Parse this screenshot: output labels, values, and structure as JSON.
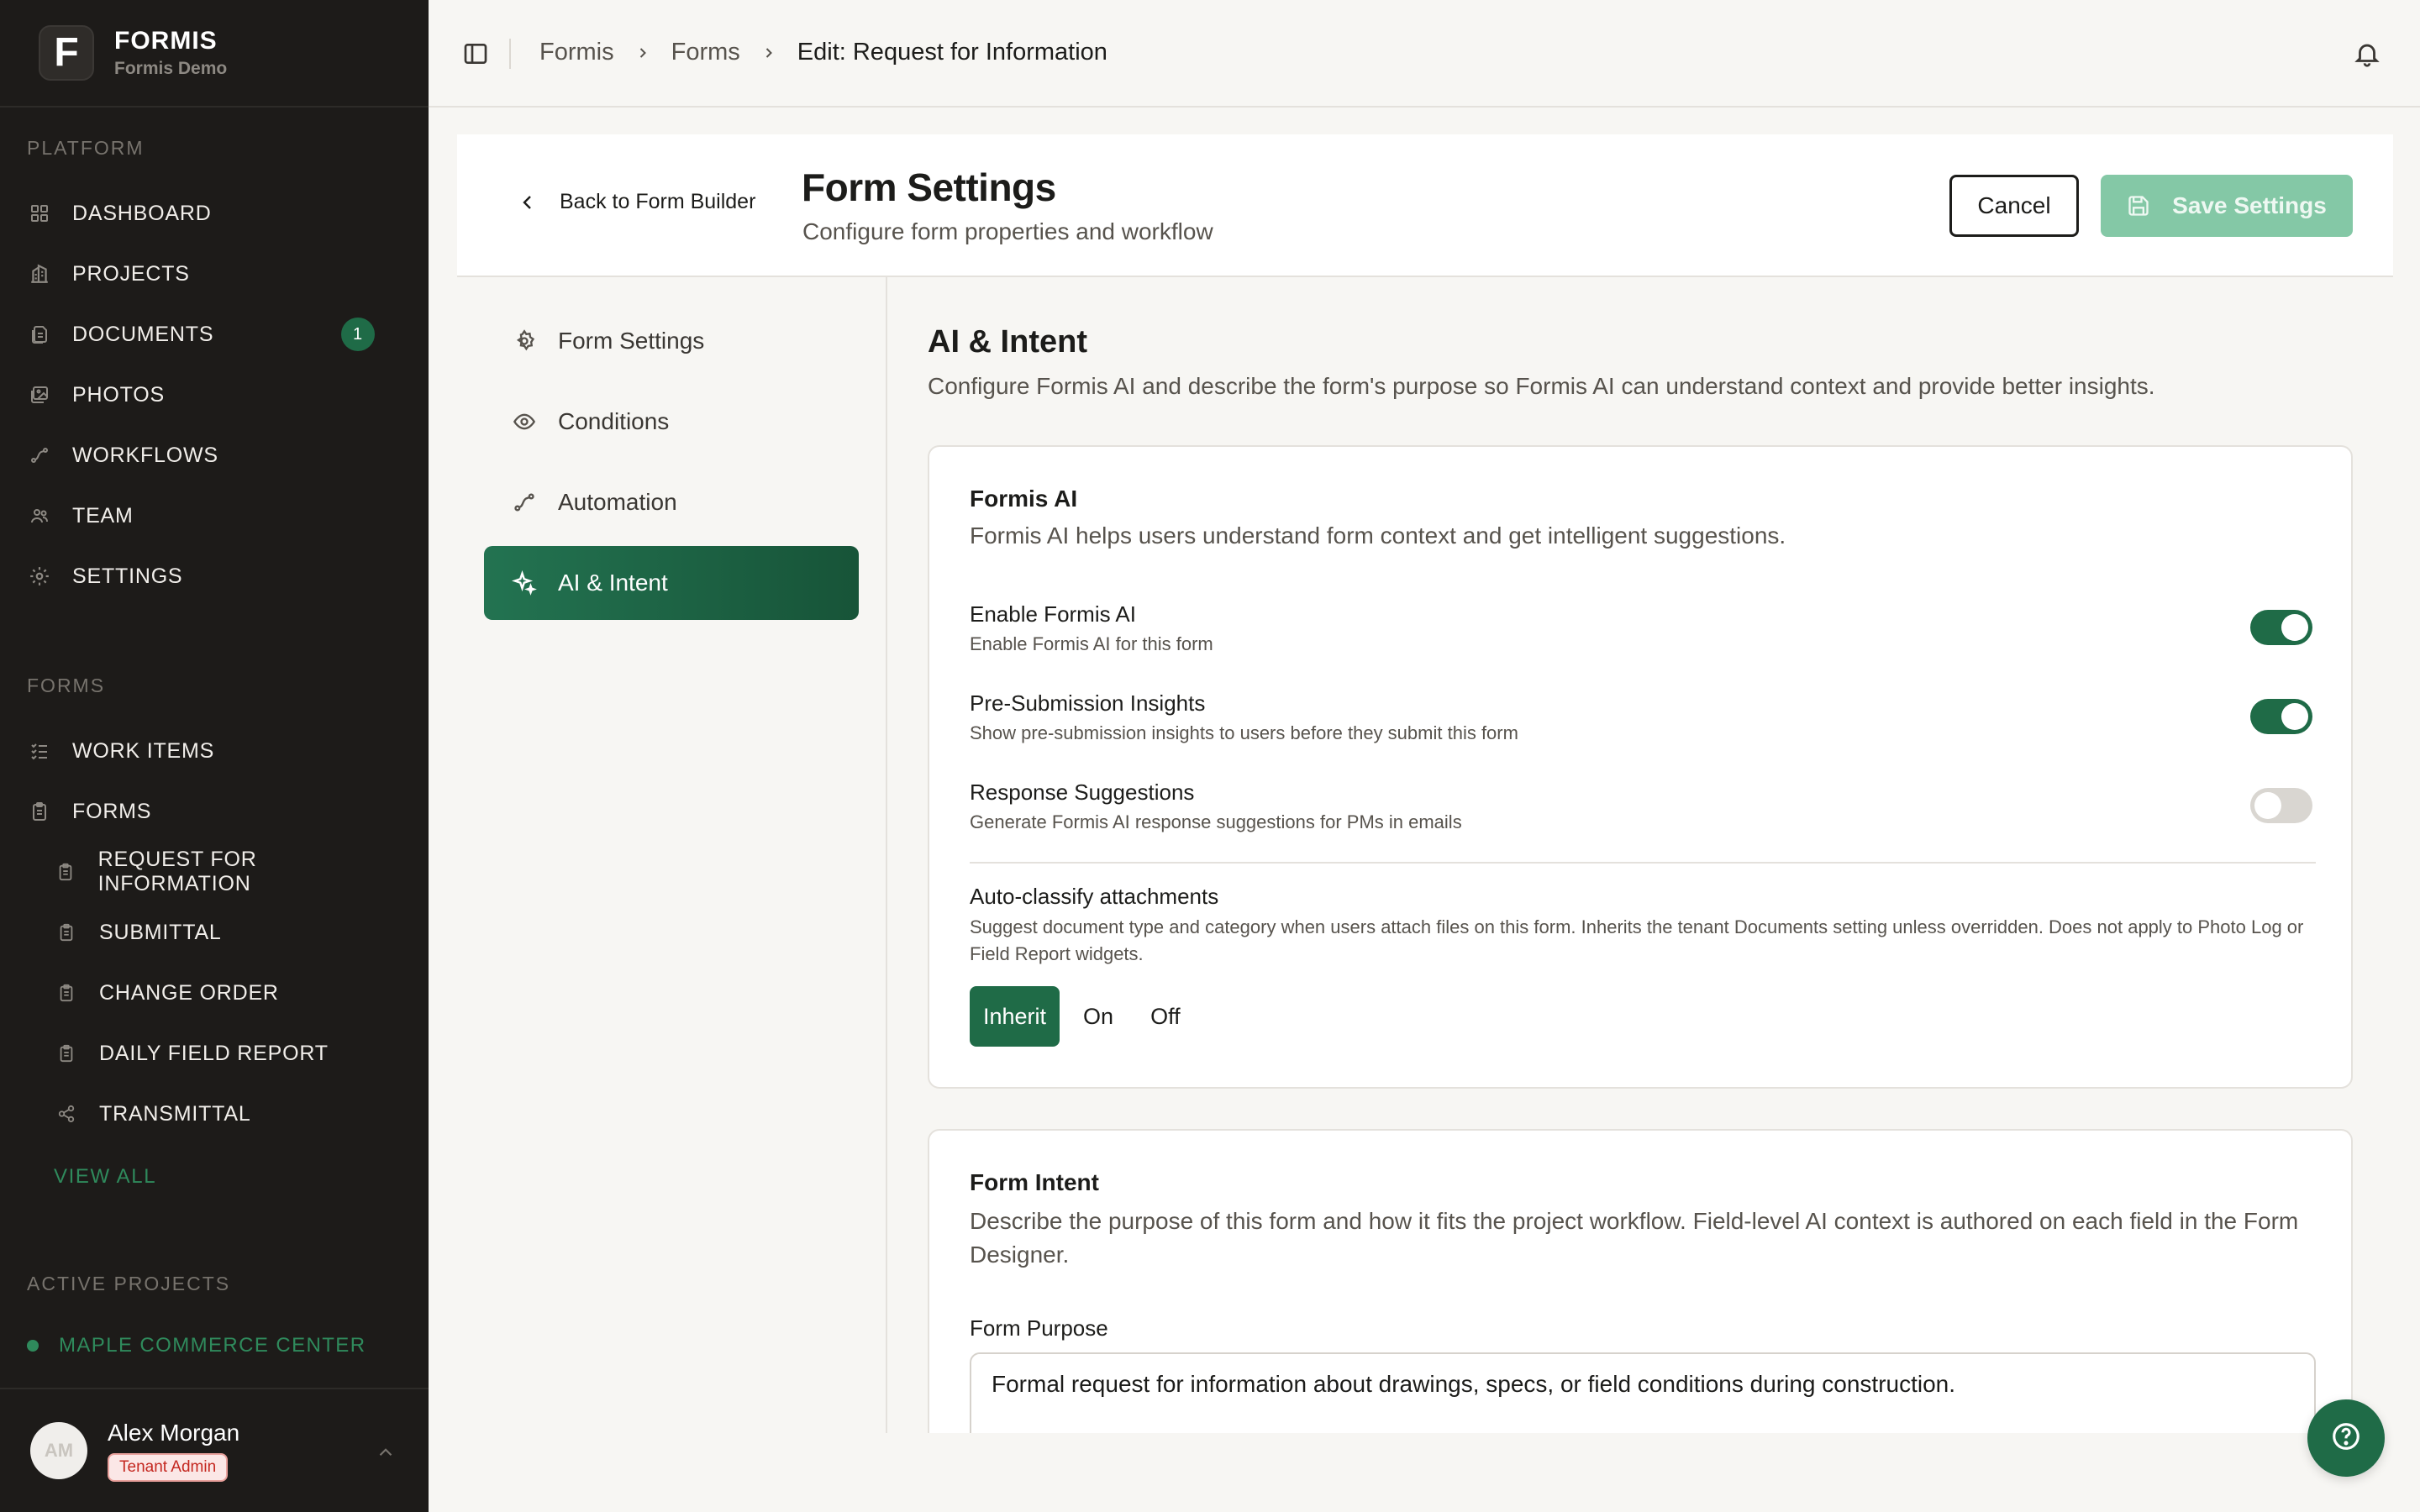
{
  "brand": {
    "name": "FORMIS",
    "subtitle": "Formis Demo",
    "logo_letter": "F"
  },
  "sidebar": {
    "platform_label": "PLATFORM",
    "platform_items": [
      {
        "label": "DASHBOARD",
        "icon": "grid-icon"
      },
      {
        "label": "PROJECTS",
        "icon": "building-icon"
      },
      {
        "label": "DOCUMENTS",
        "icon": "documents-icon",
        "badge": "1"
      },
      {
        "label": "PHOTOS",
        "icon": "photos-icon"
      },
      {
        "label": "WORKFLOWS",
        "icon": "workflow-icon"
      },
      {
        "label": "TEAM",
        "icon": "team-icon"
      },
      {
        "label": "SETTINGS",
        "icon": "gear-icon"
      }
    ],
    "forms_label": "FORMS",
    "forms_items": [
      {
        "label": "WORK ITEMS",
        "icon": "checklist-icon"
      },
      {
        "label": "FORMS",
        "icon": "clipboard-icon"
      }
    ],
    "form_subitems": [
      {
        "label": "REQUEST FOR INFORMATION",
        "icon": "clipboard-icon"
      },
      {
        "label": "SUBMITTAL",
        "icon": "clipboard-icon"
      },
      {
        "label": "CHANGE ORDER",
        "icon": "clipboard-icon"
      },
      {
        "label": "DAILY FIELD REPORT",
        "icon": "clipboard-icon"
      },
      {
        "label": "TRANSMITTAL",
        "icon": "share-icon"
      }
    ],
    "view_all": "VIEW ALL",
    "active_projects_label": "ACTIVE PROJECTS",
    "active_project": "MAPLE COMMERCE CENTER",
    "user": {
      "initials": "AM",
      "name": "Alex Morgan",
      "role": "Tenant Admin"
    }
  },
  "topbar": {
    "breadcrumbs": [
      "Formis",
      "Forms",
      "Edit: Request for Information"
    ]
  },
  "header": {
    "back_label": "Back to Form Builder",
    "title": "Form Settings",
    "subtitle": "Configure form properties and workflow",
    "cancel_label": "Cancel",
    "save_label": "Save Settings"
  },
  "settings_menu": [
    {
      "label": "Form Settings",
      "icon": "gear-icon",
      "active": false
    },
    {
      "label": "Conditions",
      "icon": "eye-icon",
      "active": false
    },
    {
      "label": "Automation",
      "icon": "workflow-icon",
      "active": false
    },
    {
      "label": "AI & Intent",
      "icon": "sparkles-icon",
      "active": true
    }
  ],
  "main": {
    "title": "AI & Intent",
    "description": "Configure Formis AI and describe the form's purpose so Formis AI can understand context and provide better insights.",
    "ai_card": {
      "title": "Formis AI",
      "description": "Formis AI helps users understand form context and get intelligent suggestions.",
      "options": [
        {
          "title": "Enable Formis AI",
          "description": "Enable Formis AI for this form",
          "enabled": true
        },
        {
          "title": "Pre-Submission Insights",
          "description": "Show pre-submission insights to users before they submit this form",
          "enabled": true
        },
        {
          "title": "Response Suggestions",
          "description": "Generate Formis AI response suggestions for PMs in emails",
          "enabled": false
        }
      ],
      "classify": {
        "title": "Auto-classify attachments",
        "description": "Suggest document type and category when users attach files on this form. Inherits the tenant Documents setting unless overridden. Does not apply to Photo Log or Field Report widgets.",
        "choices": [
          "Inherit",
          "On",
          "Off"
        ],
        "selected": "Inherit"
      }
    },
    "intent_card": {
      "title": "Form Intent",
      "description": "Describe the purpose of this form and how it fits the project workflow. Field-level AI context is authored on each field in the Form Designer.",
      "purpose_label": "Form Purpose",
      "purpose_value": "Formal request for information about drawings, specs, or field conditions during construction."
    }
  },
  "colors": {
    "accent": "#1f6b47",
    "sidebar_bg": "#1d1b19",
    "save_disabled": "#84c8a6",
    "role_badge": "#c4271f"
  }
}
